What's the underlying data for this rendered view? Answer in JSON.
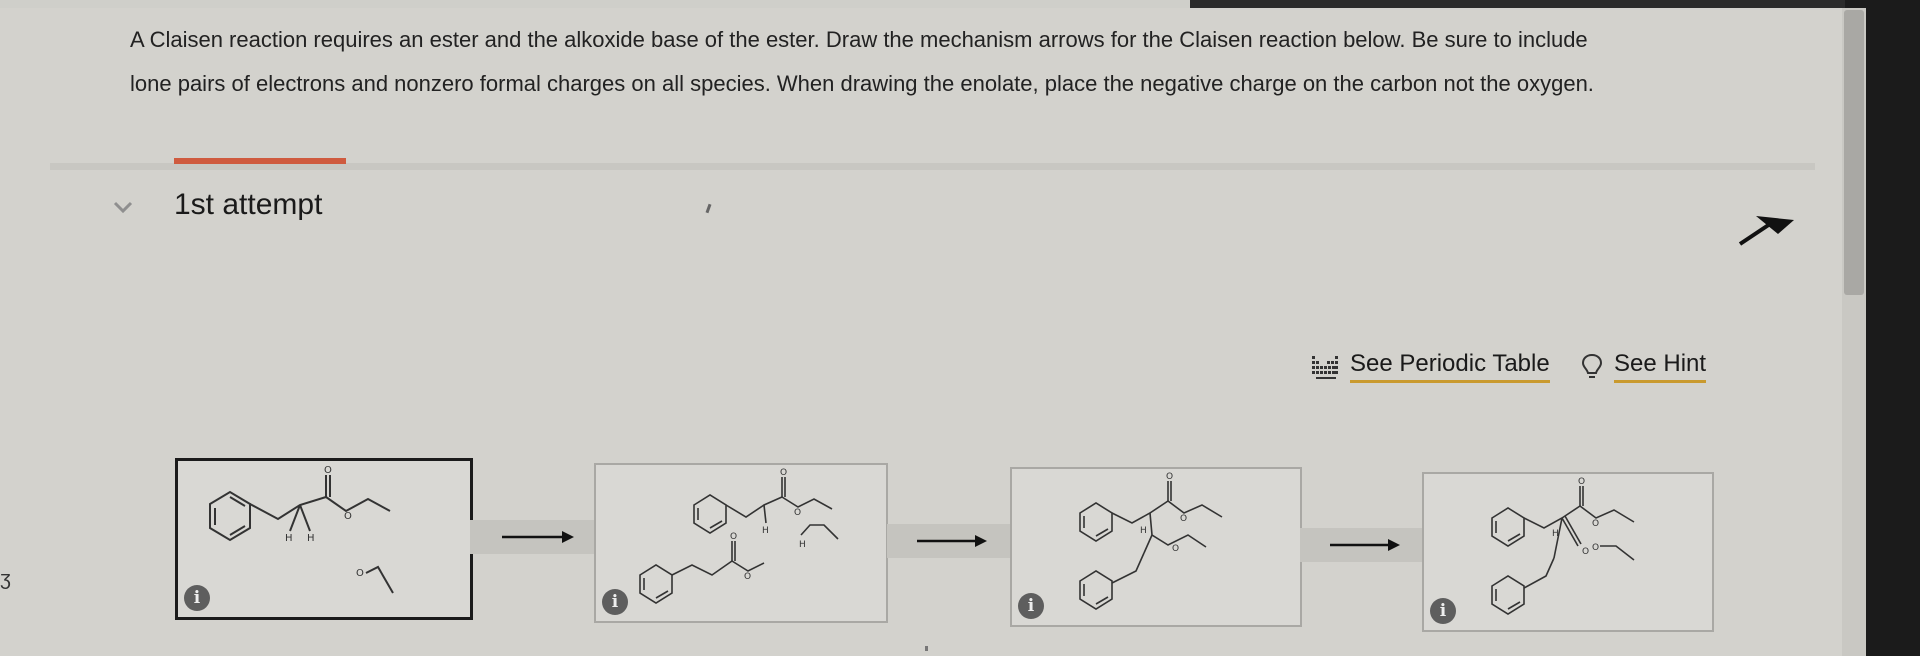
{
  "instructions": {
    "line1": "A Claisen reaction requires an ester and the alkoxide base of the ester. Draw the mechanism arrows for the Claisen reaction below. Be sure to include",
    "line2": "lone pairs of electrons and nonzero formal charges on all species. When drawing the enolate, place the negative charge on the carbon not the oxygen."
  },
  "attempt": {
    "title": "1st attempt",
    "chevron_icon": "chevron-down-icon",
    "pin_icon": "pin-icon"
  },
  "tools": {
    "periodic_table": {
      "label": "See Periodic Table",
      "icon": "periodic-table-icon"
    },
    "hint": {
      "label": "See Hint",
      "icon": "lightbulb-icon"
    }
  },
  "mechanism": {
    "steps": [
      {
        "atoms": {
          "o_top": "O",
          "o_ester": "O",
          "h1": "H",
          "h2": "H",
          "o_alkoxide": "O"
        },
        "info": "i"
      },
      {
        "atoms": {
          "o_top": "O",
          "h": "H",
          "o_ester": "O",
          "o_low": "O",
          "o_link": "O",
          "h_low": "H"
        },
        "info": "i"
      },
      {
        "atoms": {
          "o_top": "O",
          "o_ester": "O",
          "h": "H",
          "o_mid": "O"
        },
        "info": "i"
      },
      {
        "atoms": {
          "o_top": "O",
          "o_ester": "O",
          "h": "H",
          "o_ketone": "O",
          "o_alkoxide": "O"
        },
        "info": "i"
      }
    ],
    "reaction_arrow_icon": "reaction-arrow-icon"
  },
  "colors": {
    "accent": "#cf5b3f",
    "link_underline": "#c99a2e",
    "background": "#d3d2cd"
  }
}
